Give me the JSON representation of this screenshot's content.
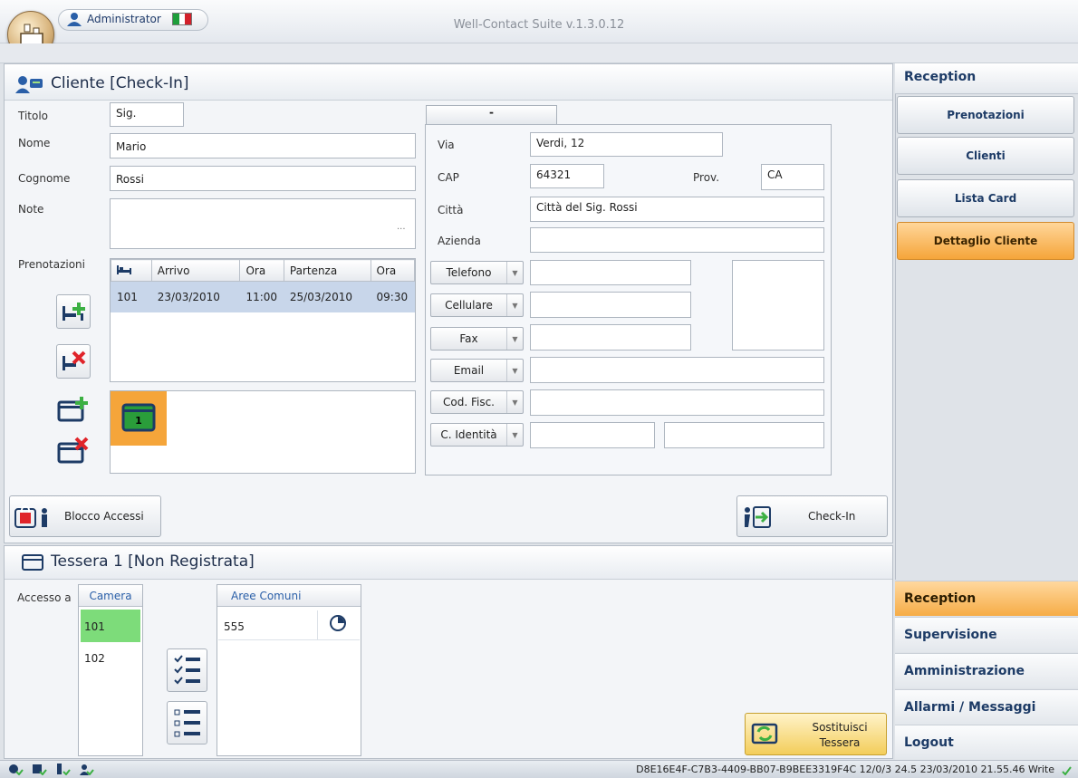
{
  "titlebar": {
    "user": "Administrator",
    "app_title": "Well-Contact Suite v.1.3.0.12"
  },
  "customer": {
    "title": "Cliente [Check-In]",
    "labels": {
      "titolo": "Titolo",
      "nome": "Nome",
      "cognome": "Cognome",
      "note": "Note",
      "prenotazioni": "Prenotazioni"
    },
    "values": {
      "titolo": "Sig.",
      "nome": "Mario",
      "cognome": "Rossi",
      "note": ""
    },
    "note_ellipsis": "...",
    "bookings": {
      "columns": [
        "",
        "Arrivo",
        "Ora",
        "Partenza",
        "Ora"
      ],
      "rows": [
        {
          "room": "101",
          "arrivo": "23/03/2010",
          "ora1": "11:00",
          "partenza": "25/03/2010",
          "ora2": "09:30"
        }
      ]
    },
    "card_number": "1"
  },
  "address": {
    "tab_label": "-",
    "labels": {
      "via": "Via",
      "cap": "CAP",
      "prov": "Prov.",
      "citta": "Città",
      "azienda": "Azienda"
    },
    "values": {
      "via": "Verdi, 12",
      "cap": "64321",
      "prov": "CA",
      "citta": "Città del Sig. Rossi",
      "azienda": ""
    },
    "contact_buttons": [
      "Telefono",
      "Cellulare",
      "Fax",
      "Email",
      "Cod. Fisc.",
      "C. Identità"
    ]
  },
  "actions": {
    "blocco": "Blocco Accessi",
    "checkin": "Check-In"
  },
  "card": {
    "title": "Tessera 1 [Non Registrata]",
    "accesso_label": "Accesso a",
    "camera_header": "Camera",
    "camera_items": [
      "101",
      "102"
    ],
    "aree_header": "Aree Comuni",
    "aree_items": [
      "555"
    ],
    "replace_line1": "Sostituisci",
    "replace_line2": "Tessera"
  },
  "sidebar": {
    "header": "Reception",
    "items": [
      "Prenotazioni",
      "Clienti",
      "Lista Card",
      "Dettaglio Cliente"
    ],
    "active_item": "Dettaglio Cliente"
  },
  "menu": {
    "items": [
      "Reception",
      "Supervisione",
      "Amministrazione",
      "Allarmi / Messaggi",
      "Logout"
    ],
    "active": "Reception"
  },
  "statusbar": {
    "text": "D8E16E4F-C7B3-4409-BB07-B9BEE3319F4C 12/0/3 24.5 23/03/2010 21.55.46 Write"
  },
  "colors": {
    "accent_orange": "#f5a53a",
    "selection_blue": "#c8d6ea",
    "room_green": "#7ddc7a",
    "header_blue": "#1d3b66"
  }
}
